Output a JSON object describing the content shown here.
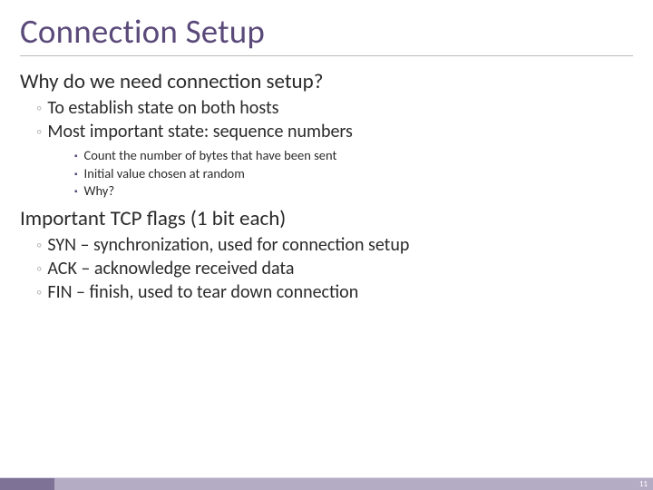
{
  "title": "Connection Setup",
  "sections": [
    {
      "heading": "Why do we need connection setup?",
      "items": [
        {
          "text": "To establish state on both hosts",
          "sub": []
        },
        {
          "text": "Most important state: sequence numbers",
          "sub": [
            "Count the number of bytes that have been sent",
            "Initial value chosen at random",
            "Why?"
          ]
        }
      ]
    },
    {
      "heading": "Important TCP flags (1 bit each)",
      "items": [
        {
          "text": "SYN – synchronization, used for connection setup",
          "sub": []
        },
        {
          "text": "ACK – acknowledge received data",
          "sub": []
        },
        {
          "text": "FIN – finish, used to tear down connection",
          "sub": []
        }
      ]
    }
  ],
  "page_number": "11"
}
